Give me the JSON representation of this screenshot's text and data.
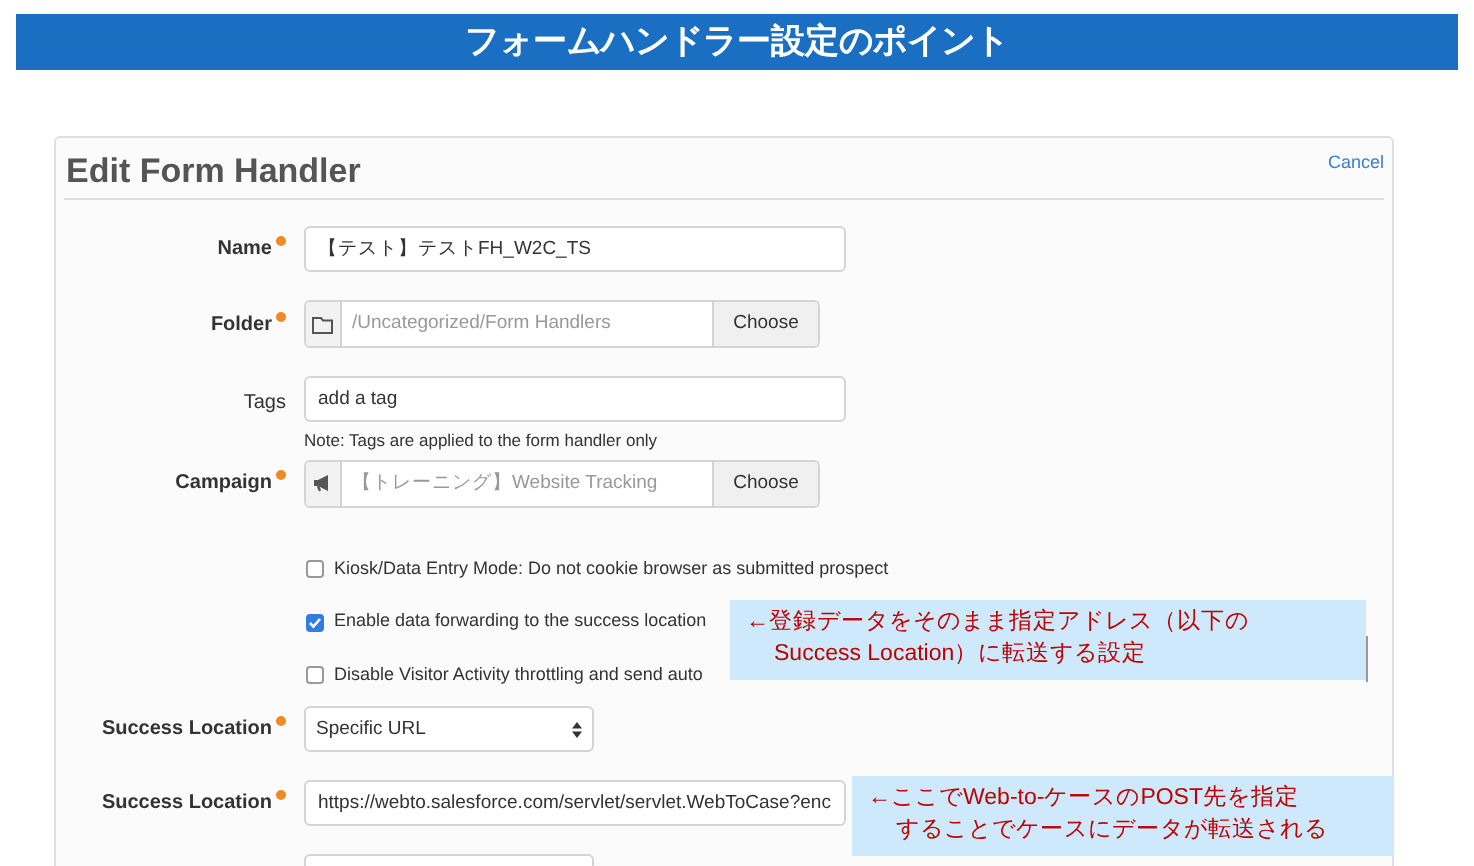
{
  "banner": {
    "title": "フォームハンドラー設定のポイント"
  },
  "panel": {
    "title": "Edit Form Handler",
    "cancel": "Cancel"
  },
  "fields": [
    {
      "kind": "text",
      "label": "Name",
      "required": true,
      "value": "【テスト】テストFH_W2C_TS"
    },
    {
      "kind": "folder",
      "label": "Folder",
      "required": true,
      "placeholder": "/Uncategorized/Form Handlers",
      "button": "Choose"
    },
    {
      "kind": "text",
      "label": "Tags",
      "required": false,
      "value": "add a tag",
      "note": "Note: Tags are applied to the form handler only"
    },
    {
      "kind": "campaign",
      "label": "Campaign",
      "required": true,
      "placeholder": "【トレーニング】Website Tracking",
      "button": "Choose"
    }
  ],
  "options": [
    {
      "label": "Kiosk/Data Entry Mode: Do not cookie browser as submitted prospect",
      "checked": false
    },
    {
      "label": "Enable data forwarding to the success location",
      "checked": true
    },
    {
      "label": "Disable Visitor Activity throttling and send auto",
      "checked": false
    }
  ],
  "success_fields": [
    {
      "kind": "select",
      "label": "Success Location",
      "required": true,
      "value": "Specific URL"
    },
    {
      "kind": "text",
      "label": "Success Location",
      "required": true,
      "value": "https://webto.salesforce.com/servlet/servlet.WebToCase?enc"
    }
  ],
  "callouts": [
    {
      "lines": [
        "←登録データをそのまま指定アドレス（以下の",
        "Success Location）に転送する設定"
      ]
    },
    {
      "lines": [
        "←ここでWeb-to-ケースのPOST先を指定",
        "することでケースにデータが転送される"
      ]
    }
  ]
}
